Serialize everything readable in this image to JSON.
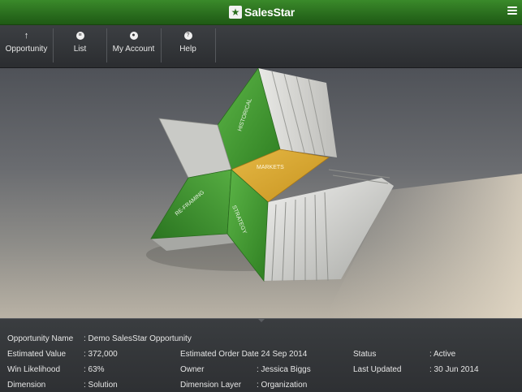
{
  "app": {
    "title": "SalesStar",
    "logo_icon": "star-icon",
    "accent": "#2f7a22"
  },
  "toolbar": {
    "items": [
      {
        "label": "Opportunity",
        "icon": "arrow-up-icon"
      },
      {
        "label": "List",
        "icon": "list-icon"
      },
      {
        "label": "My Account",
        "icon": "user-icon"
      },
      {
        "label": "Help",
        "icon": "help-icon"
      }
    ]
  },
  "star": {
    "segments": {
      "historical": "HISTORICAL",
      "markets": "MARKETS",
      "reframing": "RE-FRAMING",
      "strategy": "STRATEGY"
    },
    "colors": {
      "green": "#3e9b2e",
      "gold": "#d7a632",
      "silver": "#cfd0cc"
    }
  },
  "details": {
    "opportunity_name": {
      "label": "Opportunity Name",
      "value": ": Demo SalesStar Opportunity"
    },
    "estimated_value": {
      "label": "Estimated Value",
      "value": ": 372,000"
    },
    "estimated_order_date": {
      "label": "Estimated Order Date",
      "value": ": 24 Sep 2014"
    },
    "status": {
      "label": "Status",
      "value": ": Active"
    },
    "win_likelihood": {
      "label": "Win Likelihood",
      "value": ": 63%"
    },
    "owner": {
      "label": "Owner",
      "value": ": Jessica Biggs"
    },
    "last_updated": {
      "label": "Last Updated",
      "value": ": 30 Jun 2014"
    },
    "dimension": {
      "label": "Dimension",
      "value": ": Solution"
    },
    "dimension_layer": {
      "label": "Dimension Layer",
      "value": ": Organization"
    }
  }
}
